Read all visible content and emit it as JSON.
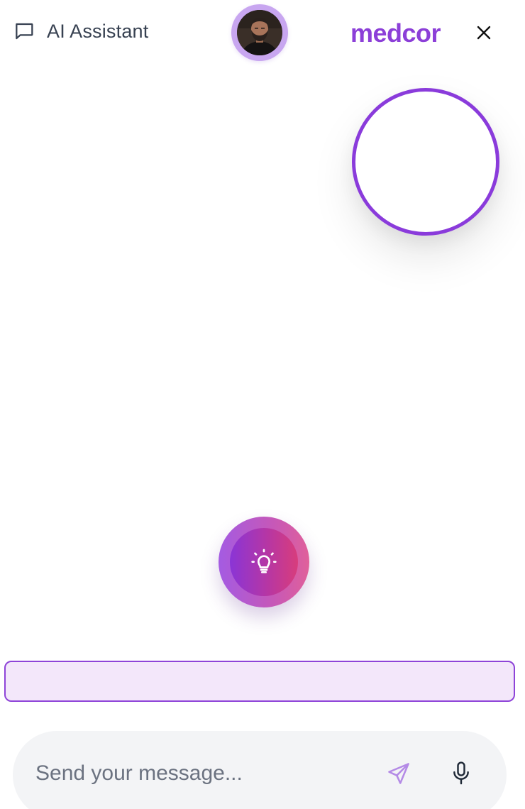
{
  "header": {
    "title": "AI Assistant",
    "chat_icon": "message-square-icon",
    "brand": "medcor",
    "close_icon": "close-icon",
    "avatar_icon": "user-avatar"
  },
  "video_preview": {
    "ring_color": "#8a3bdb"
  },
  "idea_button": {
    "icon": "lightbulb-icon"
  },
  "status_bar": {
    "text": ""
  },
  "composer": {
    "placeholder": "Send your message...",
    "value": "",
    "send_icon": "send-icon",
    "mic_icon": "microphone-icon"
  },
  "colors": {
    "brand": "#8c3fd8",
    "accent_purple": "#8a3bdb",
    "status_bg": "#f3e7fa",
    "composer_bg": "#f3f4f6",
    "idea_gradient_start": "#a45be2",
    "idea_gradient_end": "#e0609a"
  }
}
